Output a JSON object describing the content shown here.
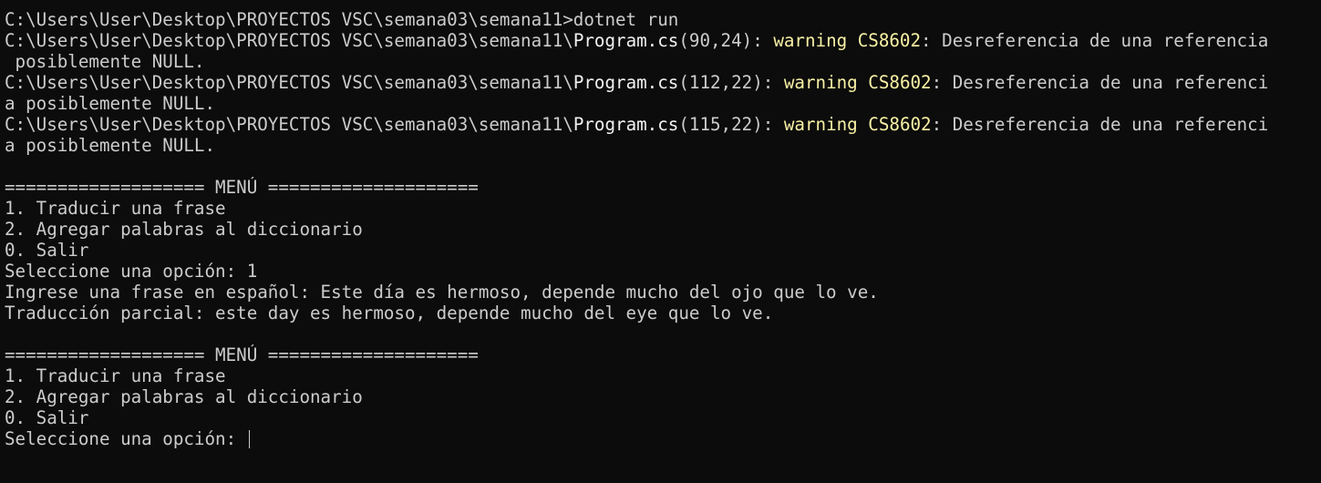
{
  "colors": {
    "background": "#0c0c0c",
    "text": "#cccccc",
    "highlight_text": "#f2f2f2",
    "warning_text": "#f9f1a5"
  },
  "command": "C:\\Users\\User\\Desktop\\PROYECTOS VSC\\semana03\\semana11>dotnet run",
  "warnings": [
    {
      "path": "C:\\Users\\User\\Desktop\\PROYECTOS VSC\\semana03\\semana11\\",
      "file": "Program.cs",
      "location": "(90,24): ",
      "code": "warning CS8602",
      "message": ": Desreferencia de una referencia",
      "wrap": " posiblemente NULL."
    },
    {
      "path": "C:\\Users\\User\\Desktop\\PROYECTOS VSC\\semana03\\semana11\\",
      "file": "Program.cs",
      "location": "(112,22): ",
      "code": "warning CS8602",
      "message": ": Desreferencia de una referenci",
      "wrap": "a posiblemente NULL."
    },
    {
      "path": "C:\\Users\\User\\Desktop\\PROYECTOS VSC\\semana03\\semana11\\",
      "file": "Program.cs",
      "location": "(115,22): ",
      "code": "warning CS8602",
      "message": ": Desreferencia de una referenci",
      "wrap": "a posiblemente NULL."
    }
  ],
  "menu1": {
    "header": "=================== MENÚ ====================",
    "items": [
      "1. Traducir una frase",
      "2. Agregar palabras al diccionario",
      "0. Salir"
    ],
    "prompt": "Seleccione una opción: 1",
    "input_line": "Ingrese una frase en español: Este día es hermoso, depende mucho del ojo que lo ve.",
    "result_line": "Traducción parcial: este day es hermoso, depende mucho del eye que lo ve."
  },
  "menu2": {
    "header": "=================== MENÚ ====================",
    "items": [
      "1. Traducir una frase",
      "2. Agregar palabras al diccionario",
      "0. Salir"
    ],
    "prompt": "Seleccione una opción: "
  }
}
